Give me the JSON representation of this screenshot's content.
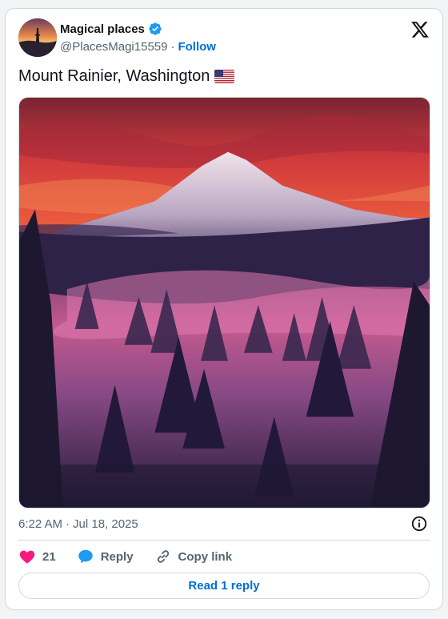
{
  "author": {
    "display_name": "Magical places",
    "handle": "@PlacesMagi15559",
    "separator": "·",
    "follow_label": "Follow"
  },
  "tweet": {
    "text": "Mount Rainier, Washington",
    "flag_icon": "us-flag-icon"
  },
  "meta": {
    "time": "6:22 AM",
    "separator": "·",
    "date": "Jul 18, 2025"
  },
  "actions": {
    "like_count": "21",
    "reply_label": "Reply",
    "copy_link_label": "Copy link"
  },
  "read_reply_label": "Read 1 reply",
  "colors": {
    "link_blue": "#006fd6",
    "verified_blue": "#1d9bf0",
    "like_pink": "#f91880",
    "reply_blue": "#1d9bf0",
    "secondary_text": "#536471"
  }
}
